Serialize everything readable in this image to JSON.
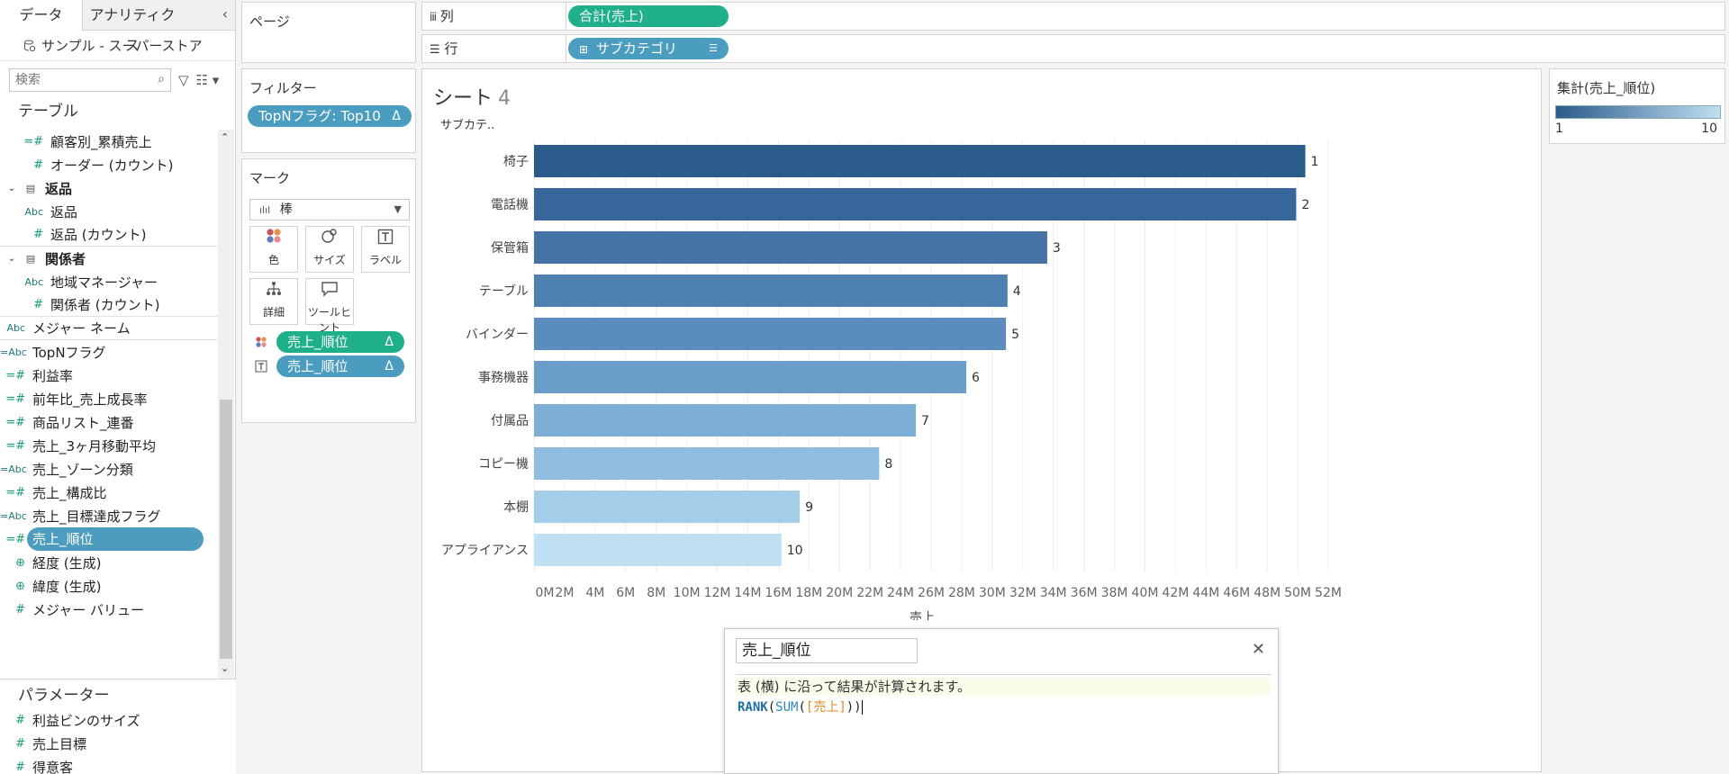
{
  "left": {
    "tabs": [
      "データ",
      "アナリティクス"
    ],
    "datasource": "サンプル - スーパーストア",
    "search_placeholder": "検索",
    "section_title": "テーブル",
    "fields": [
      {
        "icon": "=#",
        "label": "顧客別_累積売上",
        "indent": true
      },
      {
        "icon": "#",
        "label": "オーダー (カウント)",
        "indent": true
      },
      {
        "group": true,
        "label": "返品"
      },
      {
        "icon": "Abc",
        "label": "返品",
        "indent": true
      },
      {
        "icon": "#",
        "label": "返品 (カウント)",
        "indent": true,
        "underline": true
      },
      {
        "group": true,
        "label": "関係者"
      },
      {
        "icon": "Abc",
        "label": "地域マネージャー",
        "indent": true
      },
      {
        "icon": "#",
        "label": "関係者 (カウント)",
        "indent": true,
        "underline": true
      },
      {
        "icon": "Abc",
        "label": "メジャー ネーム",
        "underline": true
      },
      {
        "icon": "=Abc",
        "label": "TopNフラグ"
      },
      {
        "icon": "=#",
        "label": "利益率"
      },
      {
        "icon": "=#",
        "label": "前年比_売上成長率"
      },
      {
        "icon": "=#",
        "label": "商品リスト_連番"
      },
      {
        "icon": "=#",
        "label": "売上_3ヶ月移動平均"
      },
      {
        "icon": "=Abc",
        "label": "売上_ゾーン分類"
      },
      {
        "icon": "=#",
        "label": "売上_構成比"
      },
      {
        "icon": "=Abc",
        "label": "売上_目標達成フラグ"
      },
      {
        "icon": "=#",
        "label": "売上_順位",
        "selected": true
      },
      {
        "icon": "geo",
        "label": "経度 (生成)"
      },
      {
        "icon": "geo",
        "label": "緯度 (生成)"
      },
      {
        "icon": "#",
        "label": "メジャー バリュー"
      }
    ],
    "params_title": "パラメーター",
    "params": [
      "利益ビンのサイズ",
      "売上目標",
      "得意客"
    ]
  },
  "shelves": {
    "pages_title": "ページ",
    "filters_title": "フィルター",
    "filter_pill": "TopNフラグ: Top10",
    "marks_title": "マーク",
    "mark_type": "棒",
    "mark_buttons": [
      "色",
      "サイズ",
      "ラベル",
      "詳細",
      "ツールヒント"
    ],
    "mark_pills": [
      "売上_順位",
      "売上_順位"
    ],
    "delta": "Δ"
  },
  "columns_shelf": {
    "label": "列",
    "pill": "合計(売上)"
  },
  "rows_shelf": {
    "label": "行",
    "pill": "サブカテゴリ"
  },
  "sheet_title": "シート",
  "sheet_number": "4",
  "legend": {
    "title": "集計(売上_順位)",
    "min": "1",
    "max": "10"
  },
  "chart_data": {
    "type": "bar",
    "orientation": "horizontal",
    "row_header": "サブカテ..",
    "xlabel": "売上",
    "categories": [
      "椅子",
      "電話機",
      "保管箱",
      "テーブル",
      "バインダー",
      "事務機器",
      "付属品",
      "コピー機",
      "本棚",
      "アプライアンス"
    ],
    "values": [
      50.5,
      49.9,
      33.6,
      31.0,
      30.9,
      28.3,
      25.0,
      22.6,
      17.4,
      16.2
    ],
    "labels": [
      "1",
      "2",
      "3",
      "4",
      "5",
      "6",
      "7",
      "8",
      "9",
      "10"
    ],
    "ticks": [
      "0M",
      "2M",
      "4M",
      "6M",
      "8M",
      "10M",
      "12M",
      "14M",
      "16M",
      "18M",
      "20M",
      "22M",
      "24M",
      "26M",
      "28M",
      "30M",
      "32M",
      "34M",
      "36M",
      "38M",
      "40M",
      "42M",
      "44M",
      "46M",
      "48M",
      "50M",
      "52M"
    ],
    "xlim": [
      0,
      52
    ],
    "colors": [
      "#2b5b8a",
      "#37679a",
      "#4573a6",
      "#4e80b0",
      "#5a8dbd",
      "#6a9dca",
      "#7daed6",
      "#8fbde0",
      "#a4cde9",
      "#bfdff2"
    ]
  },
  "calc": {
    "name": "売上_順位",
    "note": "表 (横) に沿って結果が計算されます。",
    "formula": {
      "rank": "RANK",
      "sum": "SUM",
      "field": "[売上]"
    }
  }
}
